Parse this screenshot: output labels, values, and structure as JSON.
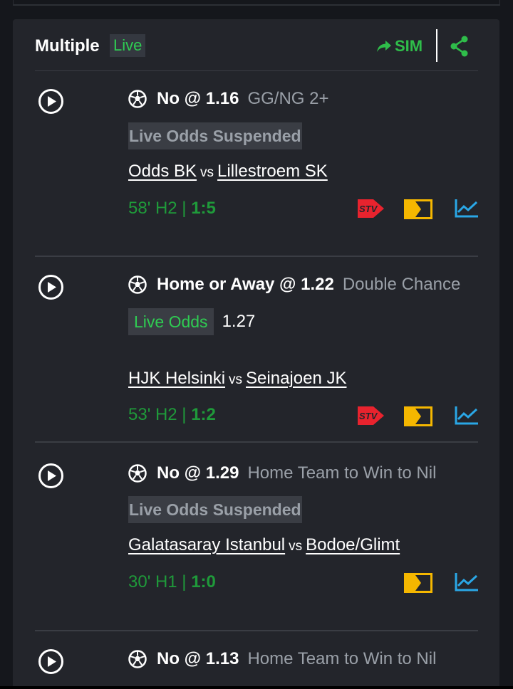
{
  "header": {
    "title": "Multiple",
    "live_label": "Live",
    "sim_label": "SIM",
    "sim_icon": "forward-arrow-icon",
    "share_icon": "share-icon"
  },
  "colors": {
    "background": "#15171c",
    "card": "#23252b",
    "green": "#2fcc52",
    "dark_green": "#1f9a3a",
    "stv_red": "#e8232e",
    "scoreboard_yellow": "#f5b700",
    "stats_blue": "#2aa7e6"
  },
  "bets": [
    {
      "selection": "No @ 1.16",
      "market": "GG/NG 2+",
      "status": "Live Odds Suspended",
      "new_odds": "",
      "home": "Odds BK",
      "vs": "vs",
      "away": "Lillestroem SK",
      "time": "58' H2 | ",
      "score": "1:5",
      "icons": [
        "stv-icon",
        "scoreboard-icon",
        "stats-chart-icon"
      ]
    },
    {
      "selection": "Home or Away @ 1.22",
      "market": "Double Chance",
      "status": "Live Odds",
      "new_odds": "1.27",
      "home": "HJK Helsinki",
      "vs": "vs",
      "away": "Seinajoen JK",
      "time": "53' H2 | ",
      "score": "1:2",
      "icons": [
        "stv-icon",
        "scoreboard-icon",
        "stats-chart-icon"
      ]
    },
    {
      "selection": "No @ 1.29",
      "market": "Home Team to Win to Nil",
      "status": "Live Odds Suspended",
      "new_odds": "",
      "home": "Galatasaray Istanbul",
      "vs": "vs",
      "away": "Bodoe/Glimt",
      "time": "30' H1 | ",
      "score": "1:0",
      "icons": [
        "scoreboard-icon",
        "stats-chart-icon"
      ]
    },
    {
      "selection": "No @ 1.13",
      "market": "Home Team to Win to Nil"
    }
  ]
}
